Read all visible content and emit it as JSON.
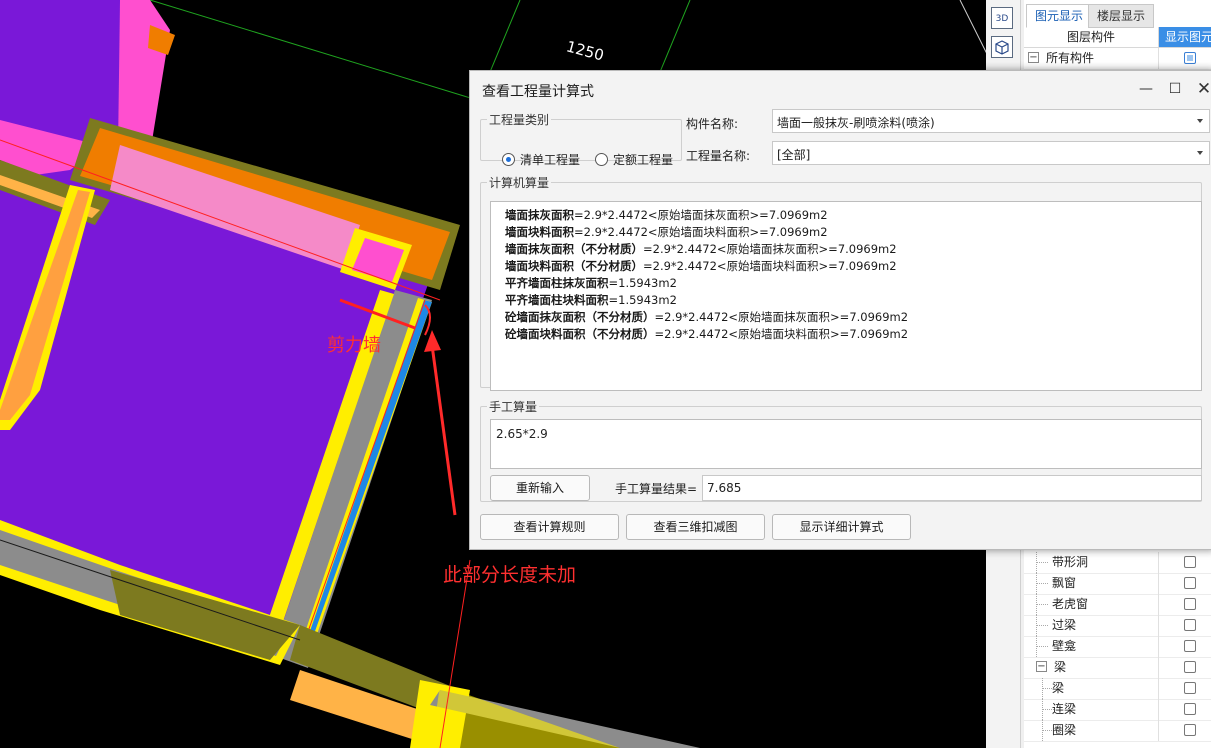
{
  "canvas": {
    "dimension_label": "1250",
    "annotation_shear_wall": "剪力墙",
    "annotation_note": "此部分长度未加"
  },
  "right_panel": {
    "toolbar": [
      {
        "icon": "3d-view-icon",
        "label": "3D"
      },
      {
        "icon": "cube-view-icon",
        "label": ""
      }
    ],
    "tabs": [
      {
        "label": "图元显示",
        "active": true
      },
      {
        "label": "楼层显示",
        "active": false
      }
    ],
    "columns": {
      "name": "图层构件",
      "show": "显示图元"
    },
    "root": {
      "label": "所有构件",
      "expander": "−",
      "checked": true
    },
    "items": [
      {
        "label": "带形洞",
        "level": 2,
        "checked": false
      },
      {
        "label": "飘窗",
        "level": 2,
        "checked": false
      },
      {
        "label": "老虎窗",
        "level": 2,
        "checked": false
      },
      {
        "label": "过梁",
        "level": 2,
        "checked": false
      },
      {
        "label": "壁龛",
        "level": 2,
        "checked": false
      },
      {
        "label": "梁",
        "level": 1,
        "expander": "−",
        "checked": false
      },
      {
        "label": "梁",
        "level": 2,
        "checked": false
      },
      {
        "label": "连梁",
        "level": 2,
        "checked": false
      },
      {
        "label": "圈梁",
        "level": 2,
        "checked": false
      }
    ]
  },
  "dialog": {
    "title": "查看工程量计算式",
    "window_controls": {
      "minimize": "—",
      "maximize": "☐",
      "close": "✕"
    },
    "quantity_type": {
      "legend": "工程量类别",
      "options": [
        {
          "label": "清单工程量",
          "selected": true
        },
        {
          "label": "定额工程量",
          "selected": false
        }
      ]
    },
    "component_name": {
      "label": "构件名称:",
      "value": "墙面一般抹灰-刷喷涂料(喷涂)"
    },
    "quantity_name": {
      "label": "工程量名称:",
      "value": "[全部]"
    },
    "computer_calc": {
      "legend": "计算机算量",
      "lines": [
        {
          "name": "墙面抹灰面积",
          "formula": "=2.9*2.4472<原始墙面抹灰面积>=7.0969m2"
        },
        {
          "name": "墙面块料面积",
          "formula": "=2.9*2.4472<原始墙面块料面积>=7.0969m2"
        },
        {
          "name": "墙面抹灰面积（不分材质）",
          "formula": "=2.9*2.4472<原始墙面抹灰面积>=7.0969m2"
        },
        {
          "name": "墙面块料面积（不分材质）",
          "formula": "=2.9*2.4472<原始墙面块料面积>=7.0969m2"
        },
        {
          "name": "平齐墙面柱抹灰面积",
          "formula": "=1.5943m2"
        },
        {
          "name": "平齐墙面柱块料面积",
          "formula": "=1.5943m2"
        },
        {
          "name": "砼墙面抹灰面积（不分材质）",
          "formula": "=2.9*2.4472<原始墙面抹灰面积>=7.0969m2"
        },
        {
          "name": "砼墙面块料面积（不分材质）",
          "formula": "=2.9*2.4472<原始墙面块料面积>=7.0969m2"
        }
      ]
    },
    "manual_calc": {
      "legend": "手工算量",
      "expression": "2.65*2.9",
      "reinput_button": "重新输入",
      "result_label": "手工算量结果=",
      "result_value": "7.685"
    },
    "buttons": {
      "view_rules": "查看计算规则",
      "view_3d": "查看三维扣减图",
      "show_detail": "显示详细计算式"
    }
  }
}
